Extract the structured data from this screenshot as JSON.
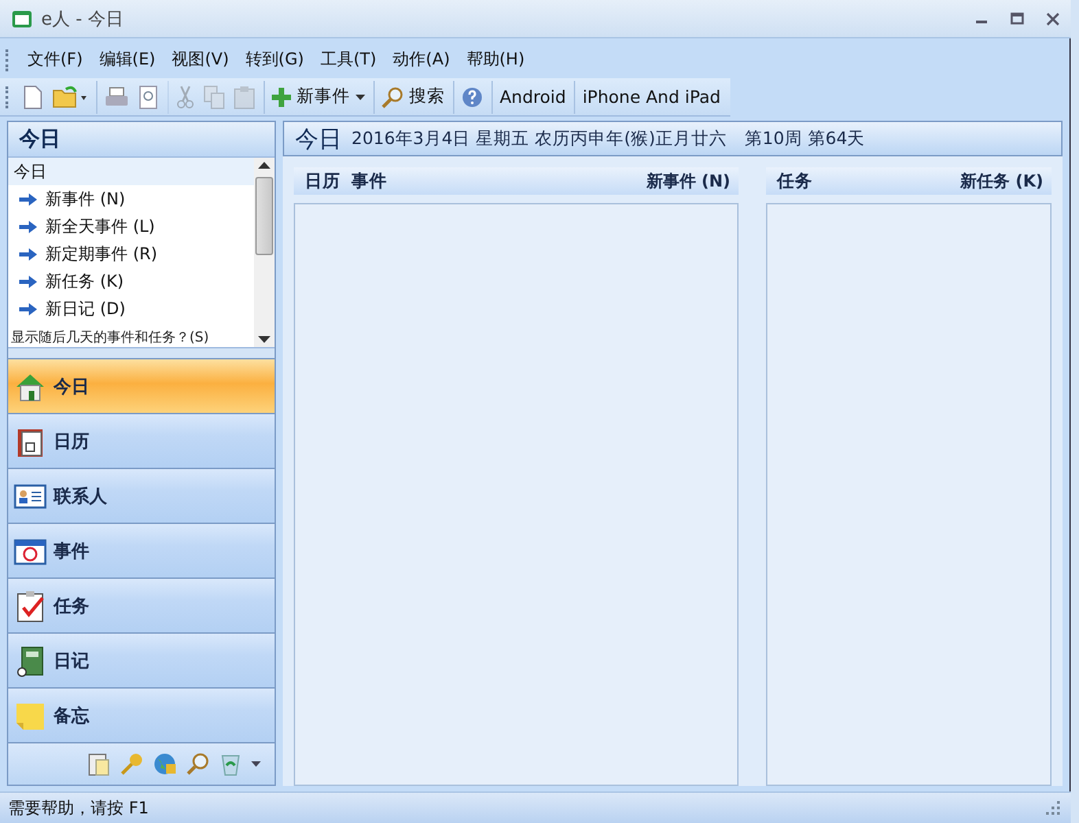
{
  "window": {
    "title": "e人 - 今日"
  },
  "menu": [
    "文件(F)",
    "编辑(E)",
    "视图(V)",
    "转到(G)",
    "工具(T)",
    "动作(A)",
    "帮助(H)"
  ],
  "toolbar": [
    {
      "kind": "new",
      "disabled": false
    },
    {
      "kind": "open",
      "disabled": false
    },
    {
      "kind": "print",
      "disabled": false
    },
    {
      "kind": "preview",
      "disabled": false
    },
    {
      "kind": "cut",
      "disabled": true
    },
    {
      "kind": "copy",
      "disabled": true
    },
    {
      "kind": "paste",
      "disabled": true
    },
    {
      "kind": "new-event",
      "label": "新事件",
      "disabled": false
    },
    {
      "kind": "search",
      "label": "搜索",
      "disabled": false
    },
    {
      "kind": "help",
      "disabled": false
    },
    {
      "kind": "text",
      "label": "Android",
      "disabled": false
    },
    {
      "kind": "text",
      "label": "iPhone And iPad",
      "disabled": false
    }
  ],
  "today_panel": {
    "title": "今日",
    "section": "今日",
    "items": [
      "新事件 (N)",
      "新全天事件 (L)",
      "新定期事件 (R)",
      "新任务 (K)",
      "新日记 (D)"
    ],
    "more": "显示随后几天的事件和任务？(S)"
  },
  "nav": [
    {
      "label": "今日",
      "kind": "home",
      "selected": true
    },
    {
      "label": "日历",
      "kind": "calendar",
      "selected": false
    },
    {
      "label": "联系人",
      "kind": "contact",
      "selected": false
    },
    {
      "label": "事件",
      "kind": "event",
      "selected": false
    },
    {
      "label": "任务",
      "kind": "task",
      "selected": false
    },
    {
      "label": "日记",
      "kind": "diary",
      "selected": false
    },
    {
      "label": "备忘",
      "kind": "note",
      "selected": false
    }
  ],
  "header": {
    "title": "今日",
    "date": "2016年3月4日 星期五 农历丙申年(猴)正月廿六",
    "week": "第10周 第64天"
  },
  "columns": [
    {
      "labels": [
        "日历",
        "事件"
      ],
      "action": "新事件 (N)"
    },
    {
      "labels": [
        "任务"
      ],
      "action": "新任务 (K)"
    }
  ],
  "status_bar": "需要帮助，请按 F1"
}
